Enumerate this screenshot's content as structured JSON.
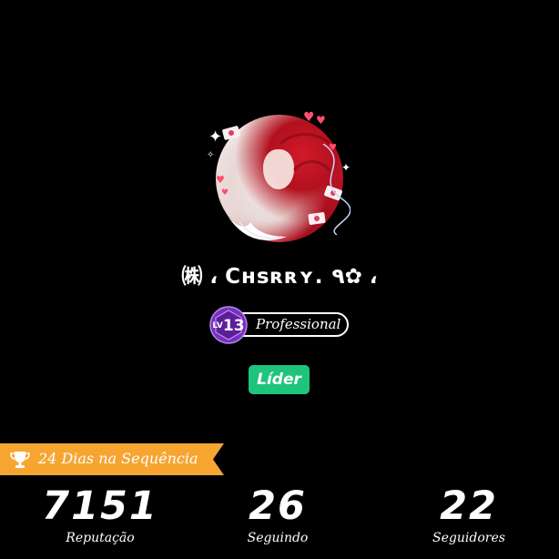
{
  "profile": {
    "name": "㈱ ، Cʜsʀʀʏ. ٩✿ ،",
    "level": {
      "prefix": "LV",
      "number": "13",
      "title": "Professional"
    },
    "role": "Líder"
  },
  "streak": {
    "label": "24 Dias na Sequência",
    "icon": "trophy-icon",
    "color": "#f6a531"
  },
  "stats": {
    "reputation": {
      "value": "7151",
      "label": "Reputação"
    },
    "following": {
      "value": "26",
      "label": "Seguindo"
    },
    "followers": {
      "value": "22",
      "label": "Seguidores"
    }
  },
  "colors": {
    "background": "#000000",
    "role_badge": "#1fc47c",
    "level_badge": "#7b2fbe",
    "streak_banner": "#f6a531"
  }
}
